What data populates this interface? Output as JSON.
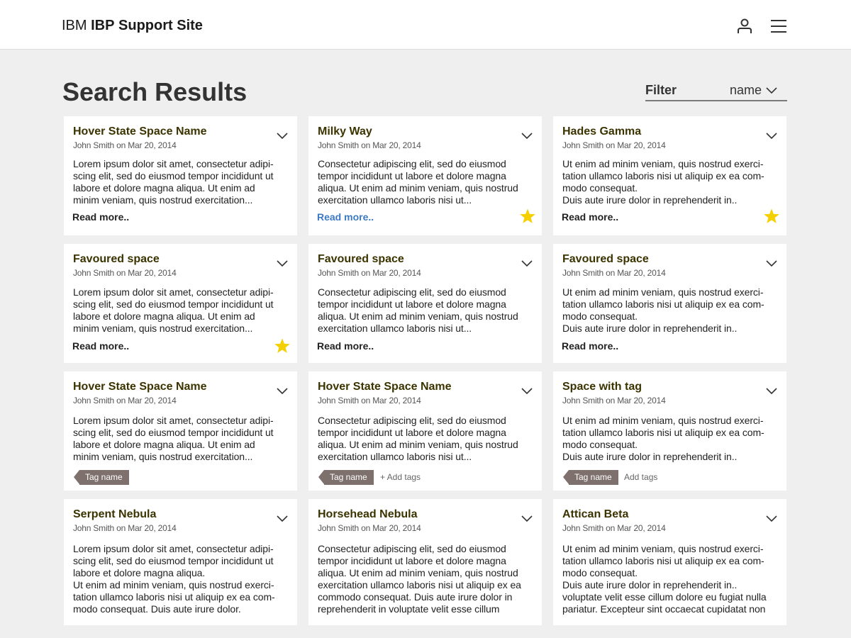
{
  "header": {
    "brand_company": "IBM",
    "brand_product": "IBP",
    "brand_site": "Support Site",
    "user_icon": "user-icon",
    "menu_icon": "hamburger-menu-icon"
  },
  "page": {
    "title": "Search Results"
  },
  "filter": {
    "label": "Filter",
    "value": "name"
  },
  "colors": {
    "title": "#3b3300",
    "star": "#f5d000",
    "tag": "#7d706d",
    "link_blue": "#3c79c4",
    "background": "#efefef"
  },
  "cards": [
    {
      "title": "Hover State Space Name",
      "meta": "John Smith on Mar 20, 2014",
      "body": "Lorem ipsum dolor sit amet, consectetur adipi-\nscing elit, sed do eiusmod tempor incididunt ut\nlabore et dolore magna aliqua. Ut enim ad\nminim veniam, quis nostrud exercitation...",
      "read_more": "Read more.."
    },
    {
      "title": "Milky Way",
      "meta": "John Smith on Mar 20, 2014",
      "body": "Consectetur adipiscing elit, sed do eiusmod\ntempor incididunt ut labore et dolore magna\naliqua. Ut enim ad minim veniam, quis nostrud\nexercitation ullamco laboris nisi ut...",
      "read_more": "Read more..",
      "favourite": true
    },
    {
      "title": "Hades Gamma",
      "meta": "John Smith on Mar 20, 2014",
      "body": "Ut enim ad minim veniam, quis nostrud exerci-\ntation ullamco laboris nisi ut aliquip ex ea com-\nmodo consequat.\nDuis aute irure dolor in reprehenderit in..",
      "read_more": "Read more..",
      "favourite": true
    },
    {
      "title": "Favoured space",
      "meta": "John Smith on Mar 20, 2014",
      "body": "Lorem ipsum dolor sit amet, consectetur adipi-\nscing elit, sed do eiusmod tempor incididunt ut\nlabore et dolore magna aliqua. Ut enim ad\nminim veniam, quis nostrud exercitation...",
      "read_more": "Read more..",
      "favourite": true
    },
    {
      "title": "Favoured space",
      "meta": "John Smith on Mar 20, 2014",
      "body": "Consectetur adipiscing elit, sed do eiusmod\ntempor incididunt ut labore et dolore magna\naliqua. Ut enim ad minim veniam, quis nostrud\nexercitation ullamco laboris nisi ut...",
      "read_more": "Read more.."
    },
    {
      "title": "Favoured space",
      "meta": "John Smith on Mar 20, 2014",
      "body": "Ut enim ad minim veniam, quis nostrud exerci-\ntation ullamco laboris nisi ut aliquip ex ea com-\nmodo consequat.\nDuis aute irure dolor in reprehenderit in..",
      "read_more": "Read more.."
    },
    {
      "title": "Hover State Space Name",
      "meta": "John Smith on Mar 20, 2014",
      "body": "Lorem ipsum dolor sit amet, consectetur adipi-\nscing elit, sed do eiusmod tempor incididunt ut\nlabore et dolore magna aliqua. Ut enim ad\nminim veniam, quis nostrud exercitation...",
      "tag": "Tag name"
    },
    {
      "title": "Hover State Space Name",
      "meta": "John Smith on Mar 20, 2014",
      "body": "Consectetur adipiscing elit, sed do eiusmod\ntempor incididunt ut labore et dolore magna\naliqua. Ut enim ad minim veniam, quis nostrud\nexercitation ullamco laboris nisi ut...",
      "tag": "Tag name",
      "add_tags": "+ Add tags"
    },
    {
      "title": "Space with tag",
      "meta": "John Smith on Mar 20, 2014",
      "body": "Ut enim ad minim veniam, quis nostrud exerci-\ntation ullamco laboris nisi ut aliquip ex ea com-\nmodo consequat.\nDuis aute irure dolor in reprehenderit in..",
      "tag": "Tag name",
      "add_tags": "Add tags"
    },
    {
      "title": "Serpent Nebula",
      "meta": "John Smith on Mar 20, 2014",
      "body": "Lorem ipsum dolor sit amet, consectetur adipi-\nscing elit, sed do eiusmod tempor incididunt ut\nlabore et dolore magna aliqua.\nUt enim ad minim veniam, quis nostrud exerci-\ntation  ullamco laboris nisi ut aliquip ex ea com-\nmodo consequat. Duis aute irure dolor."
    },
    {
      "title": "Horsehead Nebula",
      "meta": "John Smith on Mar 20, 2014",
      "body": "Consectetur adipiscing elit, sed do eiusmod\ntempor incididunt ut labore et dolore magna\naliqua. Ut enim ad minim veniam, quis nostrud\nexercitation ullamco laboris nisi ut aliquip ex ea\ncommodo consequat. Duis aute irure dolor in\nreprehenderit in voluptate velit esse cillum"
    },
    {
      "title": "Attican Beta",
      "meta": "John Smith on Mar 20, 2014",
      "body": "Ut enim ad minim veniam, quis nostrud exerci-\ntation ullamco laboris nisi ut aliquip ex ea com-\nmodo consequat.\nDuis aute irure dolor in reprehenderit in..\nvoluptate velit esse cillum dolore eu fugiat nulla\npariatur. Excepteur sint occaecat cupidatat non"
    }
  ]
}
